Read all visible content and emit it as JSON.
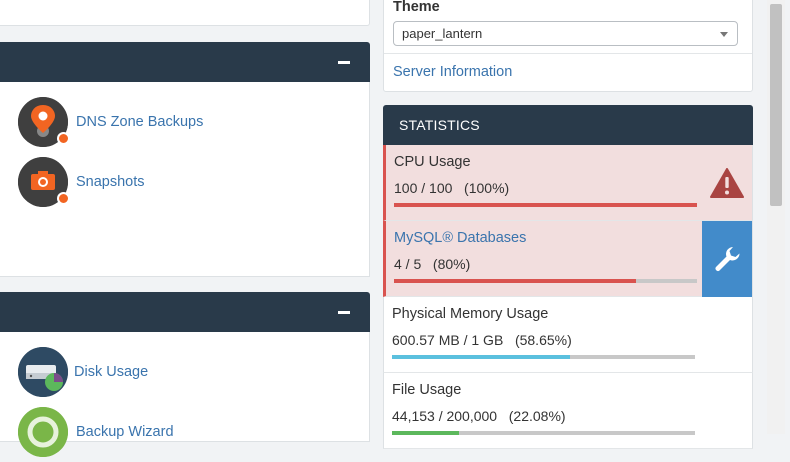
{
  "left": {
    "section1": {
      "items": [
        {
          "label": "DNS Zone Backups",
          "icon": "map-pin-icon"
        },
        {
          "label": "Snapshots",
          "icon": "camera-icon"
        }
      ]
    },
    "section2": {
      "items": [
        {
          "label": "Disk Usage",
          "icon": "disk-usage-icon"
        },
        {
          "label": "Backup Wizard",
          "icon": "backup-wizard-icon"
        }
      ]
    }
  },
  "theme": {
    "label": "Theme",
    "selected": "paper_lantern",
    "server_info": "Server Information"
  },
  "statistics": {
    "title": "STATISTICS",
    "rows": [
      {
        "name": "CPU Usage",
        "value": "100 / 100   (100%)",
        "percent": 100,
        "color": "#d9534f",
        "status": "alert",
        "action_icon": "warning-icon"
      },
      {
        "name": "MySQL® Databases",
        "value": "4 / 5   (80%)",
        "percent": 80,
        "color": "#d9534f",
        "status": "alert",
        "action_icon": "wrench-icon"
      },
      {
        "name": "Physical Memory Usage",
        "value": "600.57 MB / 1 GB   (58.65%)",
        "percent": 58.65,
        "color": "#5bc0de",
        "status": "ok"
      },
      {
        "name": "File Usage",
        "value": "44,153 / 200,000   (22.08%)",
        "percent": 22.08,
        "color": "#5cb85c",
        "status": "ok"
      }
    ]
  },
  "colors": {
    "header": "#293a4a",
    "link": "#3a74ad",
    "alert_bg": "#f2dede",
    "action_blue": "#428bca"
  }
}
